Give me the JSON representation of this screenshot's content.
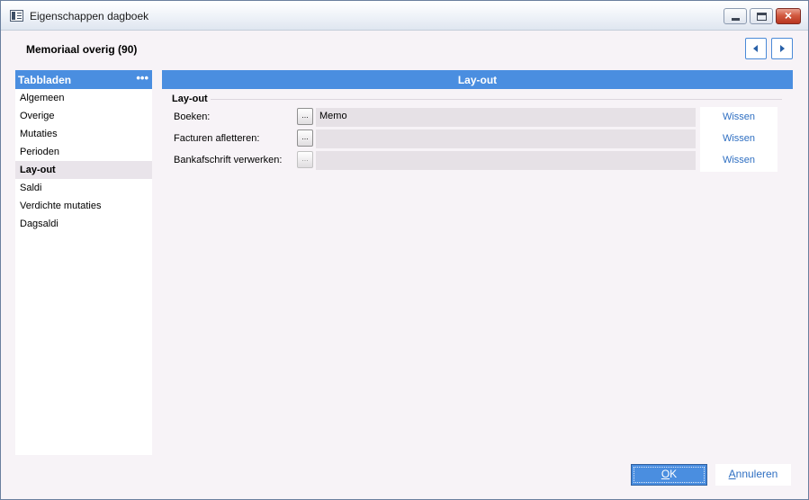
{
  "window": {
    "title": "Eigenschappen dagboek"
  },
  "header": {
    "record_title": "Memoriaal overig (90)"
  },
  "sidebar": {
    "title": "Tabbladen",
    "menu_glyph": "•••",
    "items": [
      {
        "label": "Algemeen"
      },
      {
        "label": "Overige"
      },
      {
        "label": "Mutaties"
      },
      {
        "label": "Perioden"
      },
      {
        "label": "Lay-out",
        "active": true
      },
      {
        "label": "Saldi"
      },
      {
        "label": "Verdichte mutaties"
      },
      {
        "label": "Dagsaldi"
      }
    ]
  },
  "main": {
    "section_title": "Lay-out",
    "group_label": "Lay-out",
    "rows": [
      {
        "label": "Boeken:",
        "button": "...",
        "value": "Memo",
        "clear": "Wissen"
      },
      {
        "label": "Facturen afletteren:",
        "button": "...",
        "value": "",
        "clear": "Wissen"
      },
      {
        "label": "Bankafschrift verwerken:",
        "button": "...",
        "value": "",
        "clear": "Wissen",
        "button_disabled": true
      }
    ]
  },
  "footer": {
    "ok_label_first": "O",
    "ok_label_rest": "K",
    "cancel_label_first": "A",
    "cancel_label_rest": "nnuleren"
  },
  "icons": {
    "app": "journal-window-icon",
    "prev": "chevron-left-icon",
    "next": "chevron-right-icon"
  },
  "colors": {
    "accent": "#4a8ee0",
    "link": "#2f6fc2",
    "field_bg": "#e6e1e6",
    "window_bg": "#f7f3f7"
  }
}
